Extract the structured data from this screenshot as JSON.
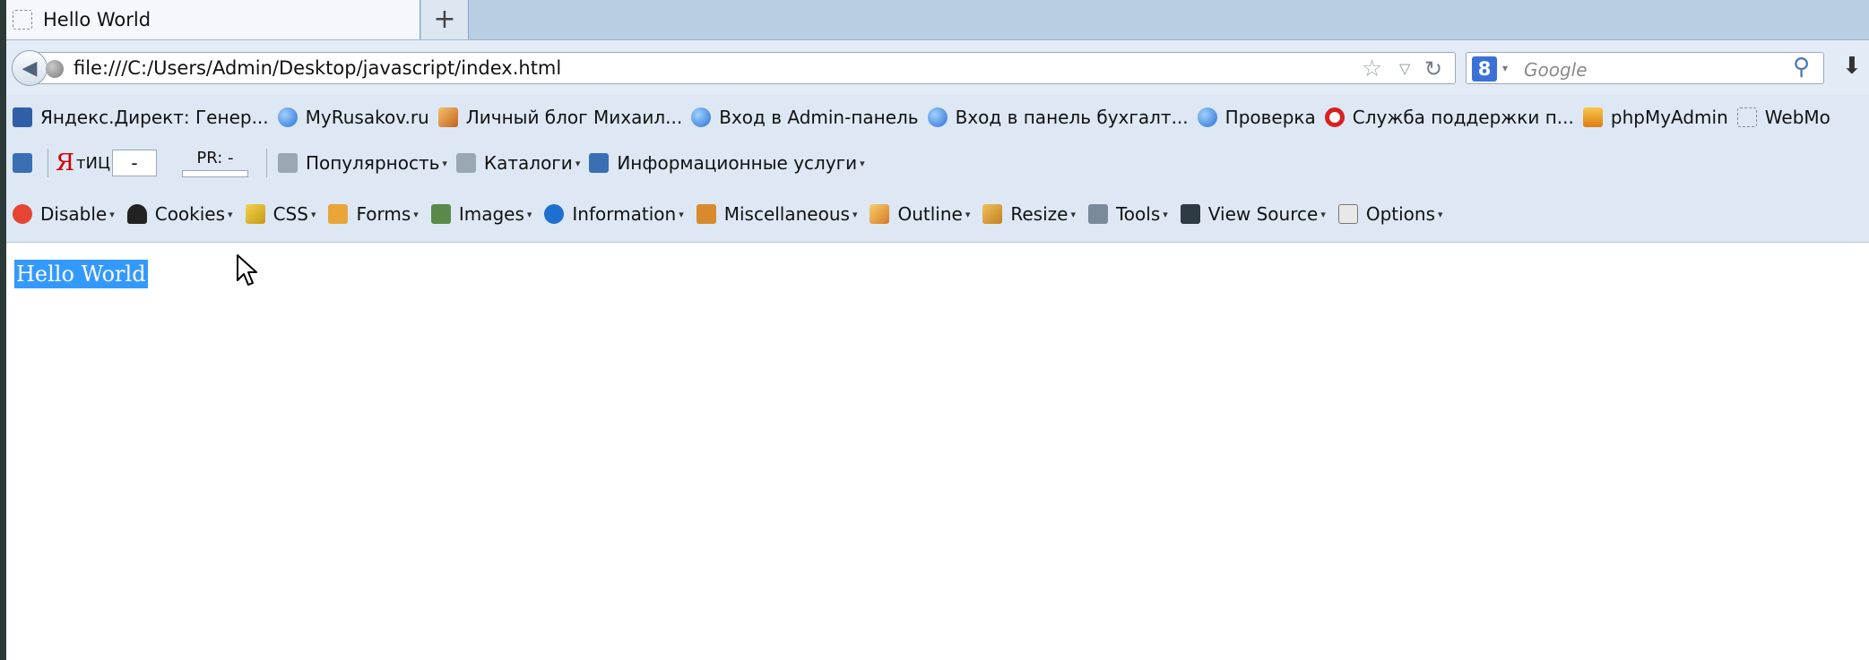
{
  "tab": {
    "title": "Hello World",
    "new_tab_label": "+"
  },
  "nav": {
    "url": "file:///C:/Users/Admin/Desktop/javascript/index.html",
    "search_placeholder": "Google",
    "search_engine_letter": "8"
  },
  "bookmarks": [
    {
      "label": "Яндекс.Директ: Генер...",
      "icon": "feed-icon"
    },
    {
      "label": "MyRusakov.ru",
      "icon": "sphere-icon"
    },
    {
      "label": "Личный блог Михаил...",
      "icon": "blog-icon"
    },
    {
      "label": "Вход в Admin-панель",
      "icon": "sphere-icon"
    },
    {
      "label": "Вход в панель бухгалт...",
      "icon": "sphere-icon"
    },
    {
      "label": "Проверка",
      "icon": "sphere-icon"
    },
    {
      "label": "Служба поддержки п...",
      "icon": "lifebuoy-icon"
    },
    {
      "label": "phpMyAdmin",
      "icon": "phpmyadmin-icon"
    },
    {
      "label": "WebMo",
      "icon": "blank-page-icon"
    }
  ],
  "yandex_bar": {
    "ya_label": "Я",
    "tic_label": "тИЦ",
    "tic_value": "-",
    "pr_label": "PR: -",
    "popularity": "Популярность",
    "catalogs": "Каталоги",
    "info_services": "Информационные услуги"
  },
  "webdev_bar": [
    {
      "label": "Disable",
      "icon": "disable-icon"
    },
    {
      "label": "Cookies",
      "icon": "cookie-icon"
    },
    {
      "label": "CSS",
      "icon": "css-wand-icon"
    },
    {
      "label": "Forms",
      "icon": "clipboard-icon"
    },
    {
      "label": "Images",
      "icon": "image-icon"
    },
    {
      "label": "Information",
      "icon": "info-icon"
    },
    {
      "label": "Miscellaneous",
      "icon": "book-icon"
    },
    {
      "label": "Outline",
      "icon": "pencil-icon"
    },
    {
      "label": "Resize",
      "icon": "ruler-icon"
    },
    {
      "label": "Tools",
      "icon": "tools-icon"
    },
    {
      "label": "View Source",
      "icon": "terminal-icon"
    },
    {
      "label": "Options",
      "icon": "options-icon"
    }
  ],
  "page": {
    "text": "Hello World",
    "selection_color": "#3399ff"
  }
}
